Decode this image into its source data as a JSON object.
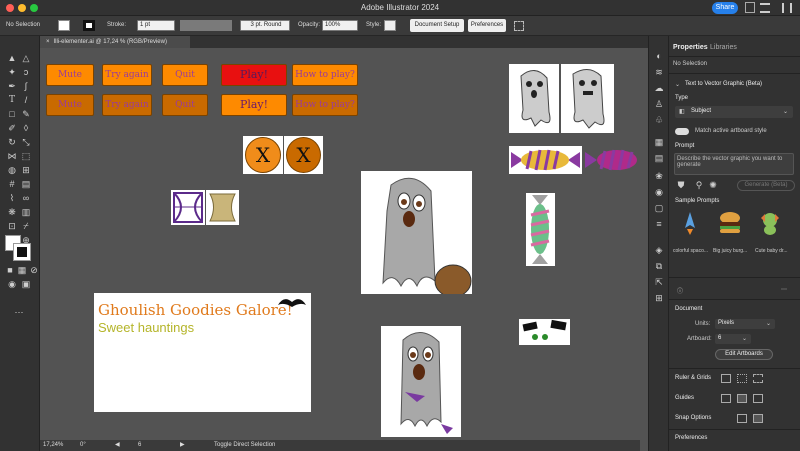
{
  "app": {
    "title": "Adobe Illustrator 2024",
    "share_label": "Share"
  },
  "control_bar": {
    "selection": "No Selection",
    "stroke_label": "Stroke:",
    "stroke_value": "1 pt",
    "brush_value": "3 pt. Round",
    "opacity_label": "Opacity:",
    "opacity_value": "100%",
    "style_label": "Style:",
    "document_setup": "Document Setup",
    "preferences": "Preferences"
  },
  "document_tab": {
    "name": "Illi-elementer.ai @ 17,24 % (RGB/Preview)",
    "close": "×"
  },
  "status_bar": {
    "zoom": "17,24%",
    "rotation": "0°",
    "artboard": "6",
    "tool": "Toggle Direct Selection"
  },
  "canvas": {
    "buttons_row1": [
      "Mute",
      "Try again",
      "Quit",
      "Play!",
      "How to play?"
    ],
    "buttons_row2": [
      "Mute",
      "Try again",
      "Quit",
      "Play!",
      "How to play?"
    ],
    "x_labels": [
      "X",
      "X"
    ],
    "banner_title": "Ghoulish Goodies Galore!",
    "banner_subtitle": "Sweet hauntings"
  },
  "properties_panel": {
    "tabs": [
      "Properties",
      "Libraries"
    ],
    "no_selection": "No Selection",
    "text_to_vector": "Text to Vector Graphic (Beta)",
    "type_label": "Type",
    "type_value": "Subject",
    "match_style": "Match active artboard style",
    "prompt_label": "Prompt",
    "prompt_placeholder": "Describe the vector graphic you want to generate",
    "generate": "Generate (Beta)",
    "sample_prompts_label": "Sample Prompts",
    "samples": [
      "colorful spaco...",
      "Big juicy burg...",
      "Cute baby dr..."
    ],
    "document_label": "Document",
    "units_label": "Units:",
    "units_value": "Pixels",
    "artboard_label": "Artboard:",
    "artboard_value": "6",
    "edit_artboards": "Edit Artboards",
    "ruler_grids": "Ruler & Grids",
    "guides": "Guides",
    "snap_options": "Snap Options",
    "preferences": "Preferences"
  }
}
